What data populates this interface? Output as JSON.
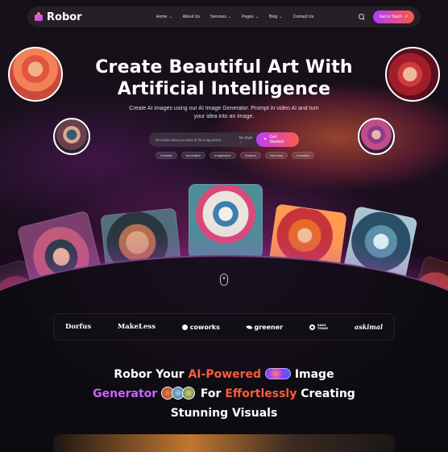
{
  "nav": {
    "brand": "Robor",
    "items": [
      {
        "label": "Home",
        "dropdown": true
      },
      {
        "label": "About Us",
        "dropdown": false
      },
      {
        "label": "Services",
        "dropdown": true
      },
      {
        "label": "Pages",
        "dropdown": true
      },
      {
        "label": "Blog",
        "dropdown": true
      },
      {
        "label": "Contact Us",
        "dropdown": false
      }
    ],
    "cta_label": "Get in Touch",
    "cta_arrow": "↗",
    "caret": "⌄"
  },
  "hero": {
    "title_line1": "Create Beautiful Art With",
    "title_line2": "Artificial Intelligence",
    "subtitle": "Create AI images using our AI Image Generator. Prompt in video AI and turn your idea into an image."
  },
  "prompt": {
    "placeholder": "Describe what you want or hit a tag below",
    "style_label": "No Style",
    "button_label": "Get Started",
    "button_icon": "✦"
  },
  "tags": [
    "Creative",
    "Innovative",
    "Imaginative",
    "Cartoon",
    "Visionary",
    "Inventive"
  ],
  "brands": [
    "Dorfus",
    "MakeLess",
    "coworks",
    "greener",
    "SAAS TODAY",
    "askimal"
  ],
  "brand_saas": {
    "line1": "SAAS",
    "line2": "TODAY"
  },
  "feature": {
    "p1": "Robor Your ",
    "p2": "AI-Powered",
    "p3": " Image",
    "p4": "Generator",
    "p5": " For ",
    "p6": "Effortlessly",
    "p7": " Creating",
    "p8": "Stunning Visuals"
  },
  "colors": {
    "accent_orange": "#ff5a3c",
    "accent_purple": "#c765ff",
    "gradient_start": "#b03cff",
    "gradient_end": "#ff5a3c"
  }
}
